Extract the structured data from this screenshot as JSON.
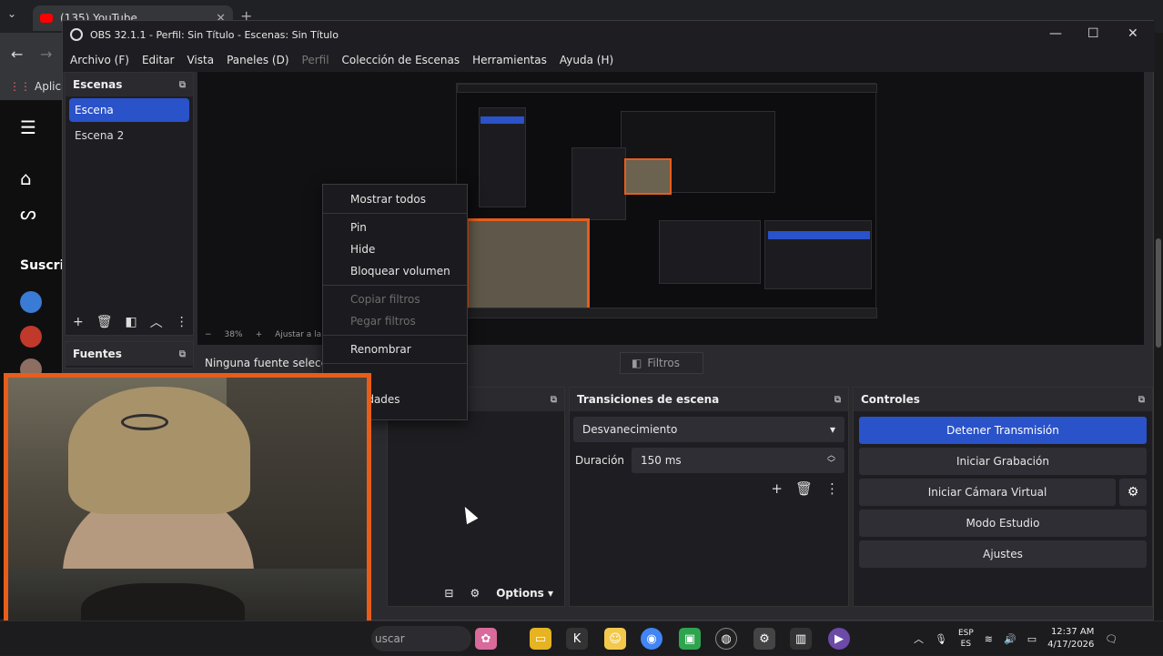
{
  "browser": {
    "tab_title": "(135) YouTube",
    "tab_close": "✕",
    "new_tab": "+",
    "bookmarks_label": "Aplicac",
    "subscriptions_label": "Suscrip"
  },
  "obs": {
    "title": "OBS 32.1.1 - Perfil: Sin Título - Escenas: Sin Título",
    "window_controls": {
      "minimize": "—",
      "maximize": "☐",
      "close": "✕"
    },
    "menu": [
      {
        "label": "Archivo (F)",
        "disabled": false
      },
      {
        "label": "Editar",
        "disabled": false
      },
      {
        "label": "Vista",
        "disabled": false
      },
      {
        "label": "Paneles (D)",
        "disabled": false
      },
      {
        "label": "Perfil",
        "disabled": true
      },
      {
        "label": "Colección de Escenas",
        "disabled": false
      },
      {
        "label": "Herramientas",
        "disabled": false
      },
      {
        "label": "Ayuda (H)",
        "disabled": false
      }
    ],
    "scenes": {
      "title": "Escenas",
      "items": [
        "Escena",
        "Escena 2"
      ],
      "selected_index": 0
    },
    "sources": {
      "title": "Fuentes"
    },
    "preview": {
      "zoom": "38%",
      "fit_label": "Ajustar a la v"
    },
    "source_toolbar": {
      "no_source_label": "Ninguna fuente selecciona",
      "filters_label": "Filtros"
    },
    "context_menu": {
      "items": [
        {
          "label": "Mostrar todos",
          "disabled": false
        },
        {
          "label": "Pin",
          "disabled": false
        },
        {
          "label": "Hide",
          "disabled": false
        },
        {
          "label": "Bloquear volumen",
          "disabled": false
        },
        {
          "label": "Copiar filtros",
          "disabled": true
        },
        {
          "label": "Pegar filtros",
          "disabled": true
        },
        {
          "label": "Renombrar",
          "disabled": false
        },
        {
          "label": "os",
          "disabled": false
        },
        {
          "label": "piedades",
          "disabled": false
        }
      ]
    },
    "audio_mixer": {
      "options_label": "Options"
    },
    "transitions": {
      "title": "Transiciones de escena",
      "selected": "Desvanecimiento",
      "duration_label": "Duración",
      "duration_value": "150 ms"
    },
    "controls": {
      "title": "Controles",
      "stop_stream": "Detener Transmisión",
      "start_recording": "Iniciar Grabación",
      "start_virtual_cam": "Iniciar Cámara Virtual",
      "studio_mode": "Modo Estudio",
      "settings": "Ajustes"
    }
  },
  "taskbar": {
    "search_label": "uscar",
    "lang_top": "ESP",
    "lang_bottom": "ES",
    "time": "12:37 AM",
    "date": "4/17/2026"
  },
  "colors": {
    "accent": "#2a52c9",
    "webcam_border": "#e85d1a"
  }
}
